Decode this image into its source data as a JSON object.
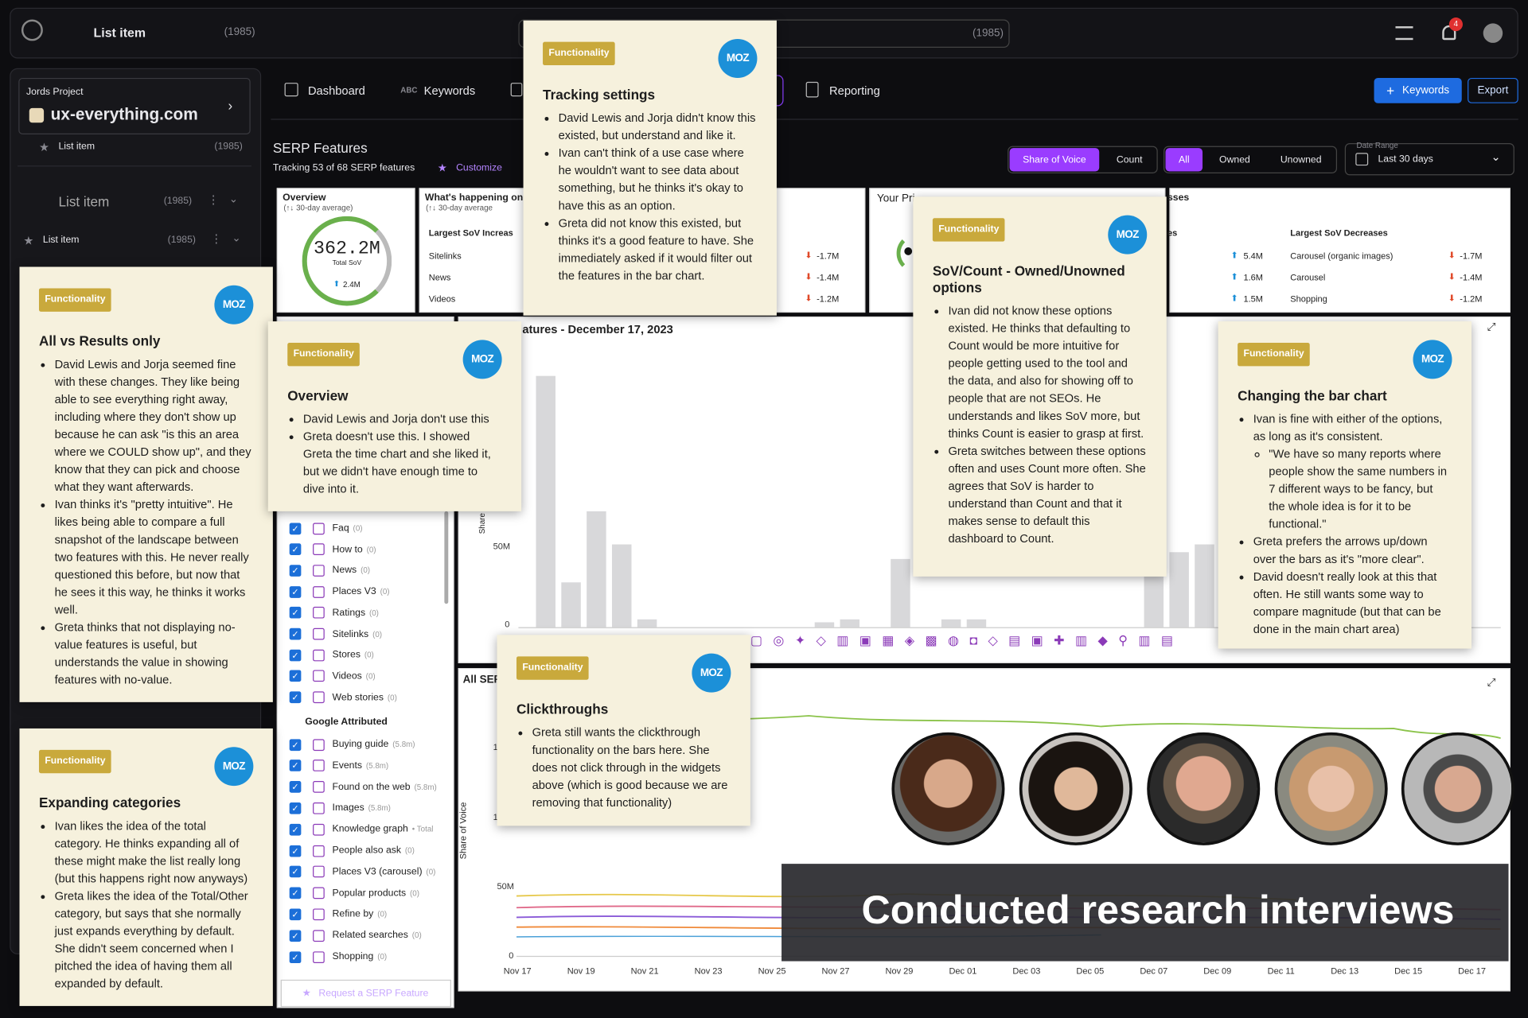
{
  "topbar": {
    "title": "List item",
    "count": "(1985)",
    "search_count": "(1985)",
    "notif_count": "4"
  },
  "sidebar": {
    "project_label": "Jords Project",
    "project_domain": "ux-everything.com",
    "items": [
      {
        "label": "List item",
        "count": "(1985)"
      },
      {
        "label": "List item",
        "count": "(1985)"
      },
      {
        "label": "List item",
        "count": "(1985)"
      }
    ]
  },
  "nav": {
    "tabs": [
      "Dashboard",
      "Keywords",
      "Reporting"
    ],
    "keywords_btn": "Keywords",
    "export_btn": "Export"
  },
  "serp": {
    "title": "SERP Features",
    "tracking": "Tracking 53 of 68 SERP features",
    "customize": "Customize",
    "toggle_sov": "Share of Voice",
    "toggle_count": "Count",
    "filter_all": "All",
    "filter_owned": "Owned",
    "filter_unowned": "Unowned",
    "date_label": "Date Range",
    "date_value": "Last 30 days"
  },
  "overview": {
    "title": "Overview",
    "subtitle": "(↑↓ 30-day average)",
    "value": "362.2M",
    "value_label": "Total SoV",
    "delta": "2.4M"
  },
  "happening": {
    "title": "What's happening on",
    "subtitle": "(↑↓ 30-day average",
    "col": "Largest SoV Increas",
    "rows": [
      {
        "name": "Sitelinks",
        "delta": "-1.7M"
      },
      {
        "name": "News",
        "delta": "-1.4M"
      },
      {
        "name": "Videos",
        "delta": "-1.2M"
      }
    ]
  },
  "primary": {
    "title": "Your Pri"
  },
  "decreases": {
    "title_frag": "sses",
    "col_frag": "es",
    "col": "Largest SoV Decreases",
    "inc_values": [
      "5.4M",
      "1.6M",
      "1.5M"
    ],
    "rows": [
      {
        "name": "Carousel (organic images)",
        "delta": "-1.7M"
      },
      {
        "name": "Carousel",
        "delta": "-1.4M"
      },
      {
        "name": "Shopping",
        "delta": "-1.2M"
      }
    ]
  },
  "bar_chart": {
    "title": "atures - December 17, 2023",
    "ylabel": "Share",
    "ytick_50m": "50M",
    "ytick_0": "0"
  },
  "chart_data": {
    "type": "bar",
    "values": [
      100,
      18,
      46,
      33,
      3,
      0,
      0,
      0,
      0,
      0,
      0,
      2,
      3,
      0,
      27,
      0,
      3,
      3,
      0,
      0,
      0,
      0,
      0,
      0,
      20,
      30,
      33,
      2,
      0,
      25,
      3,
      38
    ],
    "ylim": [
      0,
      100
    ]
  },
  "line_chart": {
    "title": "All SEF",
    "ylabel": "Share of Voice",
    "ytick_50m": "50M",
    "ytick_0": "0",
    "ytick_1a": "1",
    "ytick_1b": "1",
    "xticks": [
      "Nov 17",
      "Nov 19",
      "Nov 21",
      "Nov 23",
      "Nov 25",
      "Nov 27",
      "Nov 29",
      "Dec 01",
      "Dec 03",
      "Dec 05",
      "Dec 07",
      "Dec 09",
      "Dec 11",
      "Dec 13",
      "Dec 15",
      "Dec 17"
    ]
  },
  "features": {
    "items": [
      {
        "name": "Faq",
        "count": "(0)"
      },
      {
        "name": "How to",
        "count": "(0)"
      },
      {
        "name": "News",
        "count": "(0)"
      },
      {
        "name": "Places V3",
        "count": "(0)"
      },
      {
        "name": "Ratings",
        "count": "(0)"
      },
      {
        "name": "Sitelinks",
        "count": "(0)"
      },
      {
        "name": "Stores",
        "count": "(0)"
      },
      {
        "name": "Videos",
        "count": "(0)"
      },
      {
        "name": "Web stories",
        "count": "(0)"
      }
    ],
    "group_title": "Google Attributed",
    "group_items": [
      {
        "name": "Buying guide",
        "count": "(5.8m)"
      },
      {
        "name": "Events",
        "count": "(5.8m)"
      },
      {
        "name": "Found on the web",
        "count": "(5.8m)"
      },
      {
        "name": "Images",
        "count": "(5.8m)"
      },
      {
        "name": "Knowledge graph",
        "count": "• Total"
      },
      {
        "name": "People also ask",
        "count": "(0)"
      },
      {
        "name": "Places V3 (carousel)",
        "count": "(0)"
      },
      {
        "name": "Popular products",
        "count": "(0)"
      },
      {
        "name": "Refine by",
        "count": "(0)"
      },
      {
        "name": "Related searches",
        "count": "(0)"
      },
      {
        "name": "Shopping",
        "count": "(0)"
      }
    ],
    "request": "Request a SERP Feature"
  },
  "notes": {
    "tag": "Functionality",
    "moz": "MOZ",
    "tracking": {
      "title": "Tracking settings",
      "bullets": [
        "David Lewis and Jorja didn't know this existed, but understand and like it.",
        "Ivan can't think of a use case where he wouldn't want to see data about something, but he thinks it's okay to have this as an option.",
        "Greta did not know this existed, but thinks it's a good feature to have. She immediately asked if it would filter out the features in the bar chart."
      ]
    },
    "allvs": {
      "title": "All vs Results only",
      "bullets": [
        "David Lewis and Jorja seemed fine with these changes. They like being able to see everything right away, including where they don't show up because he can ask \"is this an area where we COULD show up\", and they know that they can pick and choose what they want afterwards.",
        "Ivan thinks it's \"pretty intuitive\". He likes being able to compare a full snapshot of the landscape between two features with this. He never really questioned this before, but now that he sees it this way, he thinks it works well.",
        "Greta thinks that not displaying no-value features is useful, but understands the value in showing features with no-value."
      ]
    },
    "overview": {
      "title": "Overview",
      "bullets": [
        "David Lewis and Jorja don't use this",
        "Greta doesn't use this. I showed Greta the time chart and she liked it, but we didn't have enough time to dive into it."
      ]
    },
    "sov": {
      "title": "SoV/Count - Owned/Unowned options",
      "bullets": [
        "Ivan did not know these options existed. He thinks that defaulting to Count would be more intuitive for people getting used to the tool and the data, and also for showing off to people that are not SEOs. He understands and likes SoV more, but thinks Count is easier to grasp at first.",
        "Greta switches between these options often and uses Count more often. She agrees that SoV is harder to understand than Count and that it makes sense to default this dashboard to Count."
      ]
    },
    "barchart": {
      "title": "Changing the bar chart",
      "b1": "Ivan is fine with either of the options, as long as it's consistent.",
      "b1sub": "\"We have so many reports where people show the same numbers in 7 different ways to be fancy, but the whole idea is for it to be functional.\"",
      "b2": "Greta prefers the arrows up/down over the bars as it's \"more clear\".",
      "b3": "David doesn't really look at this that often. He still wants some way to compare magnitude (but that can be done in the main chart area)"
    },
    "expanding": {
      "title": "Expanding categories",
      "bullets": [
        "Ivan likes the idea of the total category. He thinks expanding all of these might make the list really long (but this happens right now anyways)",
        "Greta likes the idea of the Total/Other category, but says that she normally just expands everything by default. She didn't seem concerned when I pitched the idea of having them all expanded by default."
      ]
    },
    "clickthroughs": {
      "title": "Clickthroughs",
      "bullets": [
        "Greta still wants the clickthrough functionality on the bars here. She does not click through in the widgets above (which is good because we are removing that functionality)"
      ]
    }
  },
  "banner": {
    "text": "Conducted research interviews"
  }
}
